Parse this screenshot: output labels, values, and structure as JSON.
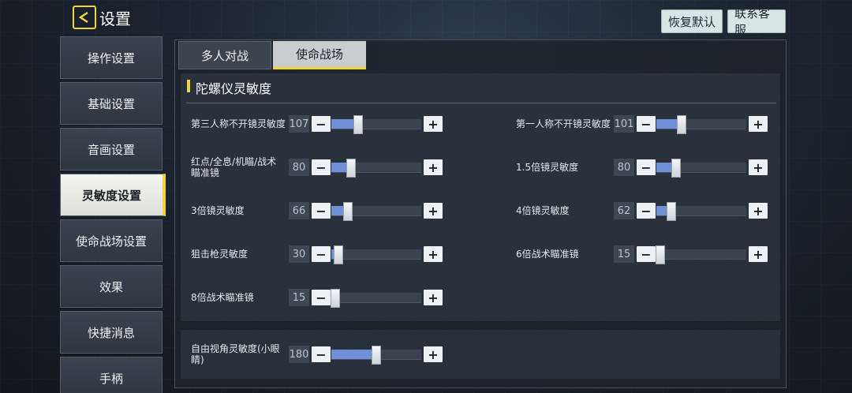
{
  "header": {
    "title": "设置",
    "restore_default": "恢复默认",
    "contact_support": "联系客服"
  },
  "sidebar": {
    "items": [
      {
        "label": "操作设置",
        "active": false
      },
      {
        "label": "基础设置",
        "active": false
      },
      {
        "label": "音画设置",
        "active": false
      },
      {
        "label": "灵敏度设置",
        "active": true
      },
      {
        "label": "使命战场设置",
        "active": false
      },
      {
        "label": "效果",
        "active": false
      },
      {
        "label": "快捷消息",
        "active": false
      },
      {
        "label": "手柄",
        "active": false
      }
    ]
  },
  "tabs": [
    {
      "label": "多人对战",
      "active": false
    },
    {
      "label": "使命战场",
      "active": true
    }
  ],
  "section": {
    "title": "陀螺仪灵敏度"
  },
  "sliders": [
    {
      "label": "第三人称不开镜灵敏度",
      "value": "107",
      "level": 0.3
    },
    {
      "label": "第一人称不开镜灵敏度",
      "value": "101",
      "level": 0.28
    },
    {
      "label": "红点/全息/机瞄/战术瞄准镜",
      "value": "80",
      "level": 0.22
    },
    {
      "label": "1.5倍镜灵敏度",
      "value": "80",
      "level": 0.22
    },
    {
      "label": "3倍镜灵敏度",
      "value": "66",
      "level": 0.18
    },
    {
      "label": "4倍镜灵敏度",
      "value": "62",
      "level": 0.17
    },
    {
      "label": "狙击枪灵敏度",
      "value": "30",
      "level": 0.08
    },
    {
      "label": "6倍战术瞄准镜",
      "value": "15",
      "level": 0.04
    },
    {
      "label": "8倍战术瞄准镜",
      "value": "15",
      "level": 0.04
    }
  ],
  "free_look": {
    "label": "自由视角灵敏度(小眼睛)",
    "value": "180",
    "level": 0.5
  },
  "controls": {
    "minus": "−",
    "plus": "+"
  },
  "colors": {
    "accent": "#f2d33a",
    "slider_fill": "#6f8fd6"
  }
}
